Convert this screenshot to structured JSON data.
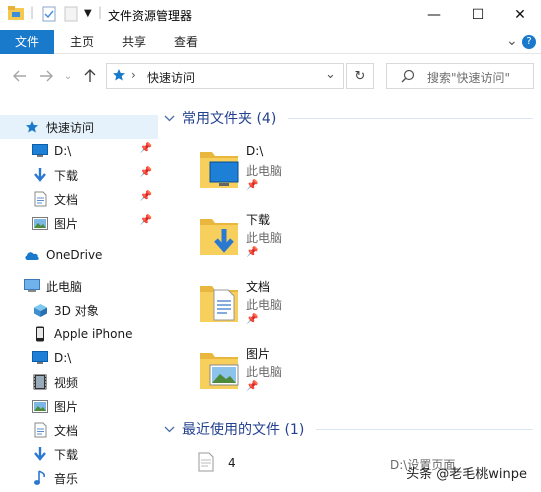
{
  "window": {
    "title": "文件资源管理器",
    "minimize_glyph": "—",
    "maximize_glyph": "☐",
    "close_glyph": "✕"
  },
  "ribbon": {
    "tabs": [
      "文件",
      "主页",
      "共享",
      "查看"
    ],
    "expand_glyph": "⌄",
    "help_glyph": "?"
  },
  "address": {
    "path": "快速访问",
    "separator": "›",
    "dropdown_glyph": "⌄",
    "refresh_glyph": "↻"
  },
  "search": {
    "placeholder": "搜索\"快速访问\""
  },
  "nav": {
    "quick_access": "快速访问",
    "pinned": [
      {
        "label": "D:\\",
        "icon": "monitor-icon"
      },
      {
        "label": "下载",
        "icon": "download-icon"
      },
      {
        "label": "文档",
        "icon": "document-icon"
      },
      {
        "label": "图片",
        "icon": "pictures-icon"
      }
    ],
    "onedrive": "OneDrive",
    "this_pc": "此电脑",
    "pc_items": [
      {
        "label": "3D 对象",
        "icon": "3d-objects-icon"
      },
      {
        "label": "Apple iPhone",
        "icon": "phone-icon"
      },
      {
        "label": "D:\\",
        "icon": "monitor-icon"
      },
      {
        "label": "视频",
        "icon": "video-icon"
      },
      {
        "label": "图片",
        "icon": "pictures-icon"
      },
      {
        "label": "文档",
        "icon": "document-icon"
      },
      {
        "label": "下载",
        "icon": "download-icon"
      },
      {
        "label": "音乐",
        "icon": "music-icon"
      }
    ]
  },
  "main": {
    "frequent_title": "常用文件夹 (4)",
    "folders": [
      {
        "name": "D:\\",
        "location": "此电脑",
        "icon": "monitor-folder-icon"
      },
      {
        "name": "下载",
        "location": "此电脑",
        "icon": "download-folder-icon"
      },
      {
        "name": "文档",
        "location": "此电脑",
        "icon": "document-folder-icon"
      },
      {
        "name": "图片",
        "location": "此电脑",
        "icon": "pictures-folder-icon"
      }
    ],
    "recent_title": "最近使用的文件 (1)",
    "recent_files": [
      {
        "name": "4",
        "path": "D:\\设置页面"
      }
    ]
  },
  "watermark": "头条 @老毛桃winpe",
  "colors": {
    "accent": "#1979ca",
    "selected": "#e5f1fb",
    "group_title": "#23418f",
    "folder_yellow": "#f5c951"
  }
}
